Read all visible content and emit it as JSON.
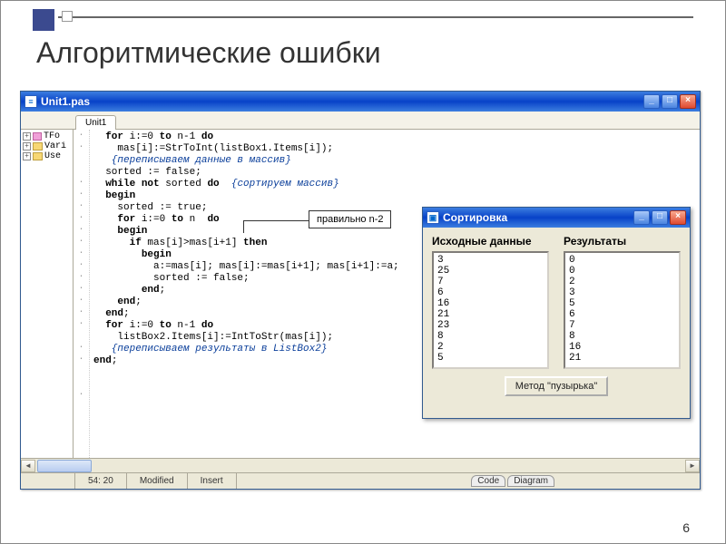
{
  "slide": {
    "title": "Алгоритмические ошибки",
    "number": "6"
  },
  "editor": {
    "title": "Unit1.pas",
    "tab": "Unit1",
    "tree": [
      "TFo",
      "Vari",
      "Use"
    ],
    "code_lines": [
      {
        "t": "  for i:=0 to n-1 do",
        "dot": true
      },
      {
        "t": "    mas[i]:=StrToInt(listBox1.Items[i]);",
        "dot": true
      },
      {
        "t": "   {переписываем данные в массив}",
        "dot": false,
        "cm": true
      },
      {
        "t": "",
        "dot": false
      },
      {
        "t": "  sorted := false;",
        "dot": true
      },
      {
        "t": "  while not sorted do  {сортируем массив}",
        "dot": true,
        "mix": true
      },
      {
        "t": "  begin",
        "dot": true,
        "kw": true
      },
      {
        "t": "    sorted := true;",
        "dot": true
      },
      {
        "t": "    for i:=0 to n  do",
        "dot": true
      },
      {
        "t": "    begin",
        "dot": true,
        "kw": true
      },
      {
        "t": "      if mas[i]>mas[i+1] then",
        "dot": true
      },
      {
        "t": "        begin",
        "dot": true,
        "kw": true
      },
      {
        "t": "          a:=mas[i]; mas[i]:=mas[i+1]; mas[i+1]:=a;",
        "dot": true
      },
      {
        "t": "          sorted := false;",
        "dot": true
      },
      {
        "t": "        end;",
        "dot": true,
        "kw": true
      },
      {
        "t": "    end;",
        "dot": true,
        "kw": true
      },
      {
        "t": "  end;",
        "dot": true,
        "kw": true
      },
      {
        "t": "",
        "dot": false
      },
      {
        "t": "  for i:=0 to n-1 do",
        "dot": true
      },
      {
        "t": "    listBox2.Items[i]:=IntToStr(mas[i]);",
        "dot": true
      },
      {
        "t": "   {переписываем результаты в ListBox2}",
        "dot": false,
        "cm": true
      },
      {
        "t": "",
        "dot": false
      },
      {
        "t": "end;",
        "dot": true,
        "kw": true
      }
    ],
    "status": {
      "pos": "54: 20",
      "mod": "Modified",
      "ins": "Insert",
      "t1": "Code",
      "t2": "Diagram"
    }
  },
  "callout": {
    "text": "правильно n-2"
  },
  "app": {
    "title": "Сортировка",
    "col1_label": "Исходные данные",
    "col2_label": "Результаты",
    "input": [
      "3",
      "25",
      "7",
      "6",
      "16",
      "21",
      "23",
      "8",
      "2",
      "5"
    ],
    "output": [
      "0",
      "0",
      "2",
      "3",
      "5",
      "6",
      "7",
      "8",
      "16",
      "21"
    ],
    "button": "Метод \"пузырька\""
  }
}
